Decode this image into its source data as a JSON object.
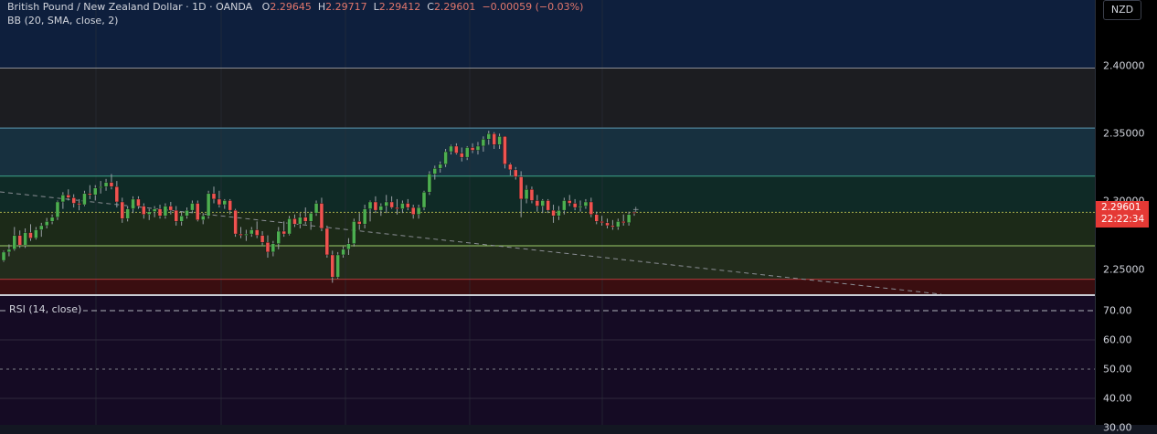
{
  "header": {
    "symbol": "British Pound / New Zealand Dollar",
    "interval": "1D",
    "exchange": "OANDA",
    "open_label": "O",
    "open": "2.29645",
    "high_label": "H",
    "high": "2.29717",
    "low_label": "L",
    "low": "2.29412",
    "close_label": "C",
    "close": "2.29601",
    "change": "−0.00059 (−0.03%)",
    "indicator": "BB (20, SMA, close, 2)"
  },
  "price_axis": {
    "currency": "NZD",
    "labels": [
      "2.40000",
      "2.35000",
      "2.30000",
      "2.25000"
    ],
    "current_price": "2.29601",
    "countdown": "22:22:34"
  },
  "rsi": {
    "label": "RSI (14, close)",
    "labels": [
      "70.00",
      "60.00",
      "50.00",
      "40.00",
      "30.00"
    ]
  },
  "colors": {
    "background": "#131722",
    "bull": "#4caf50",
    "bear": "#ef5350",
    "current_price": "#e53935",
    "zone_top": "#0e1f3d",
    "zone_dark": "#1c1d21",
    "zone_blue": "#17303f",
    "zone_teal": "#0f2a26",
    "zone_olive": "#1c2a18",
    "zone_green": "#222c1c",
    "zone_red": "#3a0e10",
    "rsi_bg": "#150b24"
  },
  "chart_data": {
    "type": "candlestick",
    "symbol": "GBP/NZD",
    "y_range": [
      2.2378,
      2.4488
    ],
    "levels": [
      2.4,
      2.357,
      2.3225,
      2.2965,
      2.2725,
      2.2485
    ],
    "candles": [
      [
        2.262,
        2.269,
        2.261,
        2.268
      ],
      [
        2.268,
        2.2735,
        2.265,
        2.27
      ],
      [
        2.27,
        2.286,
        2.269,
        2.28
      ],
      [
        2.28,
        2.2835,
        2.271,
        2.273
      ],
      [
        2.273,
        2.285,
        2.271,
        2.282
      ],
      [
        2.282,
        2.288,
        2.276,
        2.278
      ],
      [
        2.278,
        2.286,
        2.277,
        2.284
      ],
      [
        2.284,
        2.289,
        2.279,
        2.287
      ],
      [
        2.287,
        2.2925,
        2.285,
        2.29
      ],
      [
        2.29,
        2.295,
        2.288,
        2.293
      ],
      [
        2.293,
        2.305,
        2.291,
        2.304
      ],
      [
        2.304,
        2.311,
        2.299,
        2.309
      ],
      [
        2.309,
        2.313,
        2.305,
        2.307
      ],
      [
        2.307,
        2.3095,
        2.3,
        2.303
      ],
      [
        2.303,
        2.306,
        2.298,
        2.302
      ],
      [
        2.302,
        2.312,
        2.301,
        2.31
      ],
      [
        2.31,
        2.316,
        2.306,
        2.309
      ],
      [
        2.309,
        2.316,
        2.305,
        2.314
      ],
      [
        2.314,
        2.319,
        2.31,
        2.315
      ],
      [
        2.315,
        2.3205,
        2.312,
        2.318
      ],
      [
        2.318,
        2.324,
        2.313,
        2.315
      ],
      [
        2.315,
        2.319,
        2.3,
        2.304
      ],
      [
        2.304,
        2.307,
        2.289,
        2.292
      ],
      [
        2.292,
        2.301,
        2.29,
        2.299
      ],
      [
        2.299,
        2.308,
        2.296,
        2.306
      ],
      [
        2.306,
        2.308,
        2.299,
        2.301
      ],
      [
        2.301,
        2.303,
        2.292,
        2.295
      ],
      [
        2.295,
        2.299,
        2.291,
        2.297
      ],
      [
        2.297,
        2.301,
        2.293,
        2.299
      ],
      [
        2.299,
        2.302,
        2.292,
        2.294
      ],
      [
        2.294,
        2.303,
        2.292,
        2.301
      ],
      [
        2.301,
        2.304,
        2.295,
        2.298
      ],
      [
        2.298,
        2.301,
        2.287,
        2.29
      ],
      [
        2.29,
        2.297,
        2.287,
        2.294
      ],
      [
        2.294,
        2.3,
        2.292,
        2.298
      ],
      [
        2.298,
        2.305,
        2.296,
        2.303
      ],
      [
        2.303,
        2.305,
        2.29,
        2.291
      ],
      [
        2.291,
        2.296,
        2.288,
        2.294
      ],
      [
        2.294,
        2.312,
        2.292,
        2.31
      ],
      [
        2.31,
        2.315,
        2.303,
        2.306
      ],
      [
        2.306,
        2.312,
        2.3,
        2.302
      ],
      [
        2.302,
        2.306,
        2.299,
        2.305
      ],
      [
        2.305,
        2.306,
        2.295,
        2.298
      ],
      [
        2.298,
        2.299,
        2.279,
        2.281
      ],
      [
        2.281,
        2.286,
        2.278,
        2.28
      ],
      [
        2.28,
        2.284,
        2.276,
        2.281
      ],
      [
        2.281,
        2.286,
        2.279,
        2.284
      ],
      [
        2.284,
        2.29,
        2.278,
        2.28
      ],
      [
        2.28,
        2.283,
        2.273,
        2.275
      ],
      [
        2.275,
        2.28,
        2.264,
        2.268
      ],
      [
        2.268,
        2.276,
        2.265,
        2.274
      ],
      [
        2.274,
        2.286,
        2.27,
        2.283
      ],
      [
        2.283,
        2.29,
        2.279,
        2.281
      ],
      [
        2.281,
        2.294,
        2.28,
        2.292
      ],
      [
        2.292,
        2.295,
        2.286,
        2.288
      ],
      [
        2.288,
        2.296,
        2.285,
        2.293
      ],
      [
        2.293,
        2.3,
        2.288,
        2.29
      ],
      [
        2.29,
        2.297,
        2.284,
        2.296
      ],
      [
        2.296,
        2.305,
        2.294,
        2.303
      ],
      [
        2.303,
        2.307,
        2.283,
        2.285
      ],
      [
        2.285,
        2.287,
        2.264,
        2.266
      ],
      [
        2.266,
        2.269,
        2.246,
        2.25
      ],
      [
        2.25,
        2.268,
        2.249,
        2.266
      ],
      [
        2.266,
        2.272,
        2.264,
        2.27
      ],
      [
        2.27,
        2.278,
        2.266,
        2.274
      ],
      [
        2.274,
        2.292,
        2.272,
        2.29
      ],
      [
        2.29,
        2.296,
        2.284,
        2.288
      ],
      [
        2.288,
        2.302,
        2.285,
        2.299
      ],
      [
        2.299,
        2.305,
        2.29,
        2.304
      ],
      [
        2.304,
        2.308,
        2.296,
        2.298
      ],
      [
        2.298,
        2.303,
        2.294,
        2.301
      ],
      [
        2.301,
        2.309,
        2.296,
        2.304
      ],
      [
        2.304,
        2.308,
        2.299,
        2.3
      ],
      [
        2.3,
        2.306,
        2.295,
        2.299
      ],
      [
        2.299,
        2.305,
        2.296,
        2.303
      ],
      [
        2.303,
        2.306,
        2.298,
        2.3
      ],
      [
        2.3,
        2.302,
        2.292,
        2.295
      ],
      [
        2.295,
        2.302,
        2.292,
        2.3
      ],
      [
        2.3,
        2.312,
        2.298,
        2.311
      ],
      [
        2.311,
        2.326,
        2.309,
        2.324
      ],
      [
        2.324,
        2.33,
        2.32,
        2.328
      ],
      [
        2.328,
        2.333,
        2.325,
        2.331
      ],
      [
        2.331,
        2.342,
        2.329,
        2.34
      ],
      [
        2.34,
        2.345,
        2.338,
        2.344
      ],
      [
        2.344,
        2.346,
        2.338,
        2.339
      ],
      [
        2.339,
        2.343,
        2.333,
        2.336
      ],
      [
        2.336,
        2.344,
        2.334,
        2.343
      ],
      [
        2.343,
        2.346,
        2.339,
        2.341
      ],
      [
        2.341,
        2.347,
        2.338,
        2.344
      ],
      [
        2.344,
        2.351,
        2.34,
        2.349
      ],
      [
        2.349,
        2.355,
        2.345,
        2.353
      ],
      [
        2.353,
        2.354,
        2.342,
        2.345
      ],
      [
        2.345,
        2.353,
        2.342,
        2.351
      ],
      [
        2.351,
        2.351,
        2.328,
        2.331
      ],
      [
        2.331,
        2.332,
        2.323,
        2.327
      ],
      [
        2.327,
        2.329,
        2.32,
        2.322
      ],
      [
        2.322,
        2.326,
        2.293,
        2.306
      ],
      [
        2.306,
        2.316,
        2.303,
        2.313
      ],
      [
        2.313,
        2.315,
        2.303,
        2.305
      ],
      [
        2.305,
        2.309,
        2.297,
        2.301
      ],
      [
        2.301,
        2.306,
        2.296,
        2.305
      ],
      [
        2.305,
        2.306,
        2.296,
        2.298
      ],
      [
        2.298,
        2.302,
        2.289,
        2.294
      ],
      [
        2.294,
        2.301,
        2.291,
        2.298
      ],
      [
        2.298,
        2.307,
        2.295,
        2.305
      ],
      [
        2.305,
        2.309,
        2.301,
        2.303
      ],
      [
        2.303,
        2.306,
        2.298,
        2.3
      ],
      [
        2.3,
        2.305,
        2.297,
        2.301
      ],
      [
        2.301,
        2.306,
        2.299,
        2.304
      ],
      [
        2.304,
        2.307,
        2.293,
        2.295
      ],
      [
        2.295,
        2.297,
        2.288,
        2.29
      ],
      [
        2.29,
        2.294,
        2.287,
        2.289
      ],
      [
        2.289,
        2.292,
        2.285,
        2.287
      ],
      [
        2.287,
        2.291,
        2.284,
        2.286
      ],
      [
        2.286,
        2.292,
        2.284,
        2.29
      ],
      [
        2.29,
        2.295,
        2.287,
        2.289
      ],
      [
        2.289,
        2.297,
        2.287,
        2.295
      ],
      [
        2.2965,
        2.2972,
        2.2941,
        2.296
      ]
    ]
  }
}
